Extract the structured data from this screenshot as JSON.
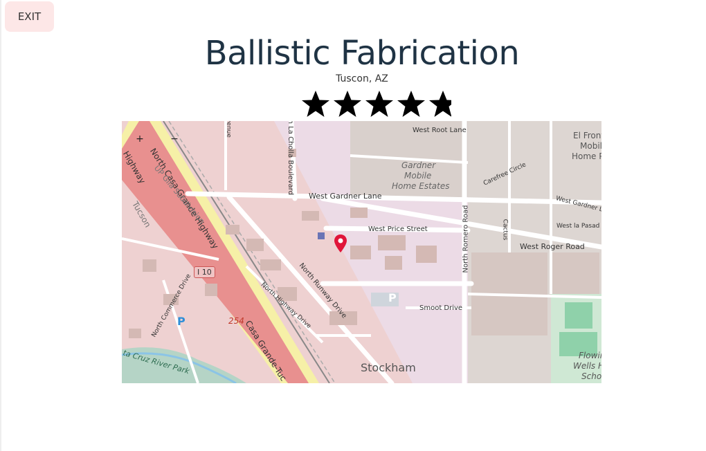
{
  "exit_label": "EXIT",
  "business": {
    "name": "Ballistic Fabrication",
    "location": "Tuscon, AZ",
    "rating": 4.5,
    "rating_max": 5
  },
  "map": {
    "zoom_in": "+",
    "zoom_out": "−",
    "labels": {
      "west_root_lane": "West Root Lane",
      "el_front": "El Front",
      "mobil": "Mobil",
      "home_pe": "Home Pe",
      "gardner": "Gardner",
      "mobile": "Mobile",
      "home_estates": "Home Estates",
      "carefree_circle": "Carefree Circle",
      "west_gardner_lane": "West Gardner Lane",
      "west_gardner_ln_r": "West Gardner Ln",
      "west_la_pasada": "West la Pasad",
      "west_price_street": "West Price Street",
      "west_roger_road": "West Roger Road",
      "north_romero_road": "North Romero Road",
      "cactus": "Cactus",
      "north_casa_grande_highway": "North Casa Grande Highway",
      "highway": "Highway",
      "up_gila_subdivision": "UP Gila Subdivision",
      "tucson": "Tucson",
      "i10": "I 10",
      "north_runway_drive": "North Runway Drive",
      "north_highway_drive": "North Highway Drive",
      "north_commerce_drive": "North Commerce Drive",
      "smoot_drive": "Smoot Drive",
      "stockham": "Stockham",
      "route_254": "254",
      "casa_grande_tuc": "Casa Grande-Tuc",
      "santa_cruz_river_park": "ta Cruz River Park",
      "flowing": "Flowin",
      "wells_h": "Wells H",
      "schoo": "Schoo",
      "parking_p": "P",
      "parking_p2": "P",
      "north_la_cholla": "North La Cholla Boulevard",
      "avenue": "venue"
    }
  }
}
